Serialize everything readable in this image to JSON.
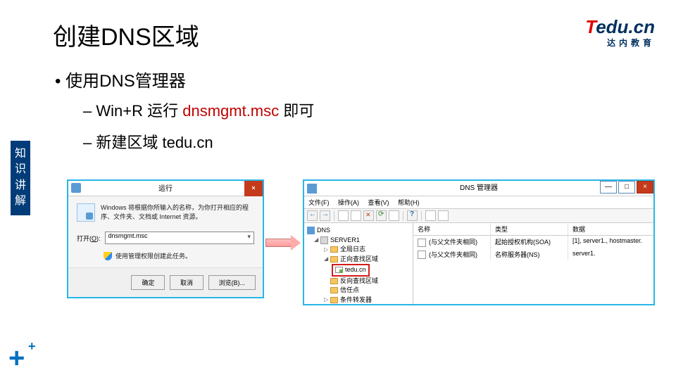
{
  "slide": {
    "title": "创建DNS区域",
    "bullet1": "使用DNS管理器",
    "bullet2a_pre": "Win+R 运行 ",
    "bullet2a_cmd": "dnsmgmt.msc",
    "bullet2a_post": " 即可",
    "bullet2b": "新建区域 tedu.cn",
    "side_tag": "知识讲解"
  },
  "logo": {
    "t": "T",
    "rest": "edu",
    "dot": ".cn",
    "subtitle": "达内教育"
  },
  "run": {
    "title": "运行",
    "close": "×",
    "desc": "Windows 将根据你所输入的名称，为你打开相应的程序、文件夹、文档或 Internet 资源。",
    "open_label_pre": "打开(",
    "open_label_u": "O",
    "open_label_post": "):",
    "input_value": "dnsmgmt.msc",
    "admin_note": "使用管理权限创建此任务。",
    "btn_ok": "确定",
    "btn_cancel": "取消",
    "btn_browse": "浏览(B)..."
  },
  "dns": {
    "title": "DNS 管理器",
    "min": "—",
    "max": "□",
    "close": "×",
    "menu": {
      "file": "文件(F)",
      "action": "操作(A)",
      "view": "查看(V)",
      "help": "帮助(H)"
    },
    "tree": {
      "root": "DNS",
      "server": "SERVER1",
      "global_log": "全局日志",
      "forward": "正向查找区域",
      "zone": "tedu.cn",
      "reverse": "反向查找区域",
      "trust": "信任点",
      "cond": "条件转发器"
    },
    "columns": {
      "name": "名称",
      "type": "类型",
      "data": "数据"
    },
    "rows": [
      {
        "name": "(与父文件夹相同)",
        "type": "起始授权机构(SOA)",
        "data": "[1], server1., hostmaster."
      },
      {
        "name": "(与父文件夹相同)",
        "type": "名称服务器(NS)",
        "data": "server1."
      }
    ]
  }
}
